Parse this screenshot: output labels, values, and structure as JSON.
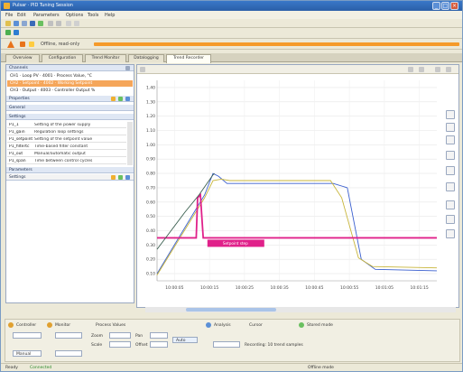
{
  "window": {
    "title": "Pulsar · PID Tuning Session"
  },
  "menu": [
    "File",
    "Edit",
    "Parameters",
    "Options",
    "Tools",
    "Help"
  ],
  "banner": {
    "label": "Offline, read-only"
  },
  "tabs": [
    "Overview",
    "Configuration",
    "Trend Monitor",
    "Datalogging",
    "Trend Recorder"
  ],
  "tabs_active": 4,
  "channels": {
    "title": "Channels",
    "items": [
      "CH1 · Loop PV · 4001 · Process Value, °C",
      "CH2 · Setpoint · 4002 · Working Setpoint",
      "CH3 · Output · 4003 · Controller Output %"
    ],
    "selected": 1
  },
  "section_labels": {
    "properties": "Properties",
    "settings": "Settings",
    "parameters": "Parameters",
    "general": "General"
  },
  "settings_rows": [
    {
      "name": "P1_1",
      "desc": "Setting of the power supply"
    },
    {
      "name": "P1_gain",
      "desc": "Regulation loop settings"
    },
    {
      "name": "P1_setpoint",
      "desc": "Setting of the setpoint value"
    },
    {
      "name": "P1_filtertc",
      "desc": "Time-based filter constant"
    },
    {
      "name": "P1_out",
      "desc": "Manual/automatic output"
    },
    {
      "name": "P1_span",
      "desc": "Time between control cycles"
    }
  ],
  "chart_data": {
    "type": "line",
    "ylim": [
      0,
      1.4
    ],
    "y_ticks": [
      "1.40",
      "1.30",
      "1.20",
      "1.10",
      "1.00",
      "0.90",
      "0.80",
      "0.70",
      "0.60",
      "0.50",
      "0.40",
      "0.30",
      "0.20",
      "0.10"
    ],
    "x_ticks": [
      "10:00:05",
      "10:00:15",
      "10:00:25",
      "10:00:35",
      "10:00:45",
      "10:00:55",
      "10:01:05",
      "10:01:15"
    ],
    "annotation": "Setpoint step",
    "series": [
      {
        "color": "#3a5fcf",
        "points": [
          [
            0,
            0.05
          ],
          [
            0.17,
            0.6
          ],
          [
            0.2,
            0.75
          ],
          [
            0.22,
            0.73
          ],
          [
            0.25,
            0.68
          ],
          [
            0.4,
            0.68
          ],
          [
            0.55,
            0.68
          ],
          [
            0.63,
            0.68
          ],
          [
            0.68,
            0.65
          ],
          [
            0.73,
            0.15
          ],
          [
            0.78,
            0.08
          ],
          [
            1,
            0.07
          ]
        ]
      },
      {
        "color": "#c8b53a",
        "points": [
          [
            0,
            0.04
          ],
          [
            0.17,
            0.58
          ],
          [
            0.2,
            0.7
          ],
          [
            0.23,
            0.71
          ],
          [
            0.26,
            0.7
          ],
          [
            0.4,
            0.7
          ],
          [
            0.55,
            0.7
          ],
          [
            0.62,
            0.7
          ],
          [
            0.66,
            0.58
          ],
          [
            0.72,
            0.16
          ],
          [
            0.77,
            0.1
          ],
          [
            1,
            0.09
          ]
        ]
      },
      {
        "color": "#e0218a",
        "points": [
          [
            0,
            0.3
          ],
          [
            0.14,
            0.3
          ],
          [
            0.145,
            0.58
          ],
          [
            0.155,
            0.6
          ],
          [
            0.165,
            0.3
          ],
          [
            1,
            0.3
          ]
        ]
      },
      {
        "color": "#3a5f4f",
        "points": [
          [
            0.0,
            0.22
          ],
          [
            0.05,
            0.35
          ],
          [
            0.1,
            0.48
          ],
          [
            0.15,
            0.6
          ],
          [
            0.2,
            0.74
          ],
          [
            0.205,
            0.75
          ]
        ]
      }
    ]
  },
  "bottom": {
    "sections": [
      "Controller",
      "Monitor",
      "Process Values",
      "Analysis",
      "Cursor"
    ],
    "fields": [
      "Zoom",
      "Pan",
      "Scale",
      "Offset",
      "Auto",
      "Manual"
    ],
    "status": "Recording: 10 trend samples",
    "mode_label": "Stored mode"
  },
  "status": {
    "left": "Ready",
    "middle": "Connected",
    "right": "Offline mode"
  },
  "colors": {
    "accent": "#f59a2a",
    "selection": "#f5a65a",
    "trend_pink": "#e0218a"
  }
}
